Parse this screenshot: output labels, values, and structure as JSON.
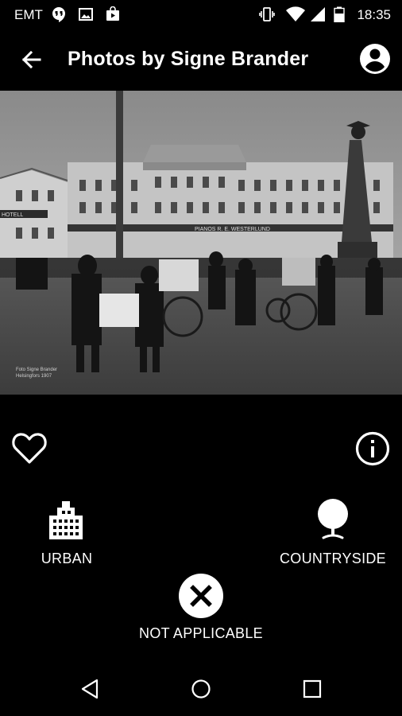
{
  "status_bar": {
    "carrier": "EMT",
    "time": "18:35",
    "icons": [
      "hangouts-icon",
      "image-icon",
      "play-store-icon",
      "vibrate-icon",
      "wifi-icon",
      "signal-icon",
      "battery-icon"
    ]
  },
  "app_bar": {
    "title": "Photos by Signe Brander",
    "back_icon": "arrow-back-icon",
    "account_icon": "account-circle-icon"
  },
  "photo": {
    "caption_line1": "Foto Signe Brander",
    "caption_line2": "Helsingfors 1907",
    "shop_sign": "PIANOS R. E. WESTERLUND",
    "hotel_sign": "HOTELL"
  },
  "actions": {
    "favorite_icon": "heart-outline-icon",
    "info_icon": "info-outline-icon"
  },
  "choices": {
    "urban": {
      "label": "URBAN",
      "icon": "city-icon"
    },
    "countryside": {
      "label": "COUNTRYSIDE",
      "icon": "tree-icon"
    },
    "not_applicable": {
      "label": "NOT APPLICABLE",
      "icon": "close-circle-icon"
    }
  },
  "nav_bar": {
    "icons": [
      "back-triangle-icon",
      "home-circle-icon",
      "recents-square-icon"
    ]
  }
}
